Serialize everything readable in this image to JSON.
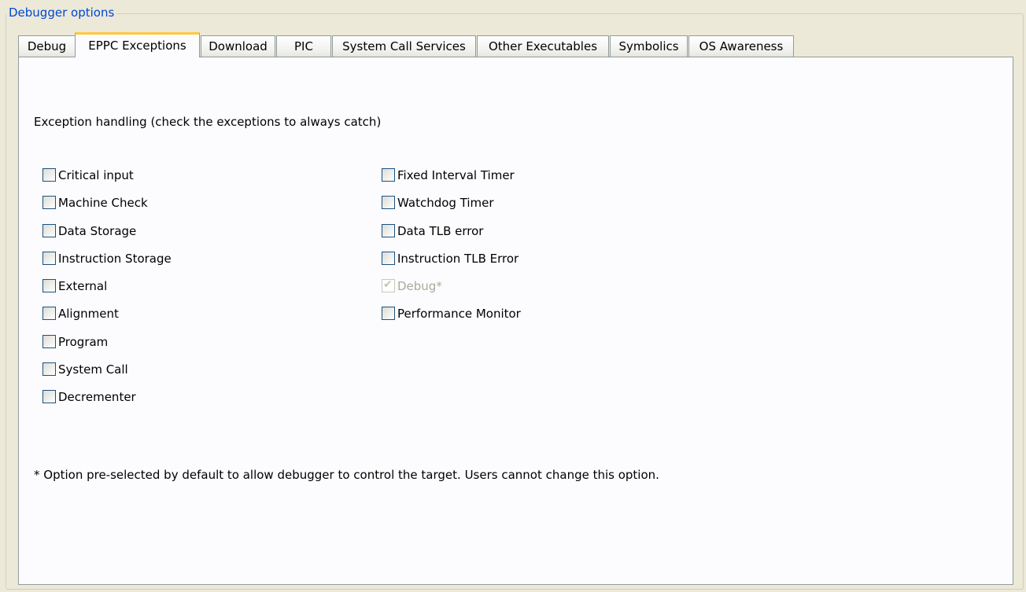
{
  "group": {
    "title": "Debugger options"
  },
  "tabs": [
    {
      "label": "Debug",
      "active": false
    },
    {
      "label": "EPPC Exceptions",
      "active": true
    },
    {
      "label": "Download",
      "active": false
    },
    {
      "label": "PIC",
      "active": false
    },
    {
      "label": "System Call Services",
      "active": false
    },
    {
      "label": "Other Executables",
      "active": false
    },
    {
      "label": "Symbolics",
      "active": false
    },
    {
      "label": "OS Awareness",
      "active": false
    }
  ],
  "panel": {
    "heading": "Exception handling (check the exceptions to always catch)",
    "left_exceptions": [
      {
        "label": "Critical input",
        "checked": false,
        "disabled": false
      },
      {
        "label": "Machine Check",
        "checked": false,
        "disabled": false
      },
      {
        "label": "Data Storage",
        "checked": false,
        "disabled": false
      },
      {
        "label": "Instruction Storage",
        "checked": false,
        "disabled": false
      },
      {
        "label": "External",
        "checked": false,
        "disabled": false
      },
      {
        "label": "Alignment",
        "checked": false,
        "disabled": false
      },
      {
        "label": "Program",
        "checked": false,
        "disabled": false
      },
      {
        "label": "System Call",
        "checked": false,
        "disabled": false
      },
      {
        "label": "Decrementer",
        "checked": false,
        "disabled": false
      }
    ],
    "right_exceptions": [
      {
        "label": "Fixed Interval Timer",
        "checked": false,
        "disabled": false
      },
      {
        "label": "Watchdog Timer",
        "checked": false,
        "disabled": false
      },
      {
        "label": "Data TLB error",
        "checked": false,
        "disabled": false
      },
      {
        "label": "Instruction TLB Error",
        "checked": false,
        "disabled": false
      },
      {
        "label": "Debug*",
        "checked": true,
        "disabled": true
      },
      {
        "label": "Performance Monitor",
        "checked": false,
        "disabled": false
      }
    ],
    "footnote": "* Option pre-selected by default to allow debugger to control the target. Users cannot change this option."
  },
  "colors": {
    "group_title": "#0046d5",
    "active_tab_accent": "#ffc83c",
    "window_background": "#ece9d8",
    "panel_background": "#fcfcfe",
    "disabled_text": "#aca899"
  }
}
